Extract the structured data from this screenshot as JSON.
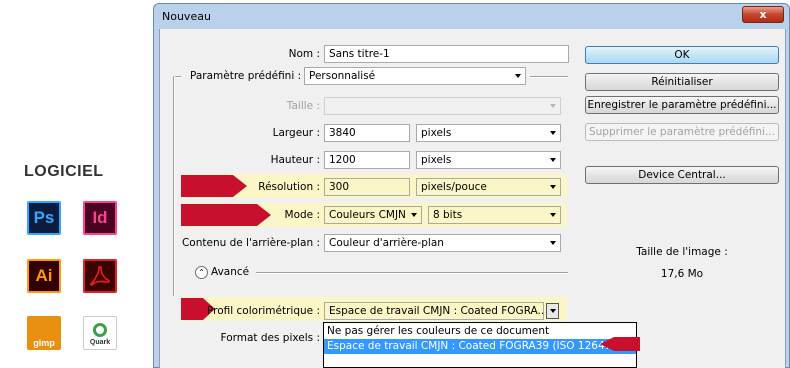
{
  "software_panel": {
    "title": "LOGICIEL",
    "logos": [
      {
        "name": "photoshop",
        "text": "Ps"
      },
      {
        "name": "indesign",
        "text": "Id"
      },
      {
        "name": "illustrator",
        "text": "Ai"
      },
      {
        "name": "acrobat",
        "icon": "acrobat-icon"
      },
      {
        "name": "gimp",
        "text": "gimp"
      },
      {
        "name": "quark",
        "text": "Quark"
      }
    ]
  },
  "window": {
    "title": "Nouveau",
    "close_label": "x"
  },
  "form": {
    "nom": {
      "label": "Nom :",
      "value": "Sans titre-1"
    },
    "preset": {
      "label": "Paramètre prédéfini :",
      "value": "Personnalisé"
    },
    "taille": {
      "label": "Taille :",
      "value": ""
    },
    "largeur": {
      "label": "Largeur :",
      "value": "3840",
      "unit": "pixels"
    },
    "hauteur": {
      "label": "Hauteur :",
      "value": "1200",
      "unit": "pixels"
    },
    "resolution": {
      "label": "Résolution :",
      "value": "300",
      "unit": "pixels/pouce"
    },
    "mode": {
      "label": "Mode :",
      "value": "Couleurs CMJN",
      "depth": "8 bits"
    },
    "contenu": {
      "label": "Contenu de l'arrière-plan :",
      "value": "Couleur d'arrière-plan"
    },
    "avance": {
      "label": "Avancé"
    },
    "profil": {
      "label": "Profil colorimétrique :",
      "value": "Espace de travail CMJN : Coated FOGRA..."
    },
    "format": {
      "label": "Format des pixels :"
    }
  },
  "dropdown_options": [
    "Ne pas gérer les couleurs de ce document",
    "Espace de travail CMJN : Coated FOGRA39 (ISO 12647..."
  ],
  "dropdown_selected_index": 1,
  "buttons": {
    "ok": "OK",
    "reset": "Réinitialiser",
    "save_preset": "Enregistrer le paramètre prédéfini...",
    "delete_preset": "Supprimer le paramètre prédéfini...",
    "device_central": "Device Central..."
  },
  "image_size": {
    "label": "Taille de l'image :",
    "value": "17,6 Mo"
  },
  "colors": {
    "highlight": "#fbf6c5",
    "arrow": "#c8102e",
    "selection": "#3399ff"
  }
}
